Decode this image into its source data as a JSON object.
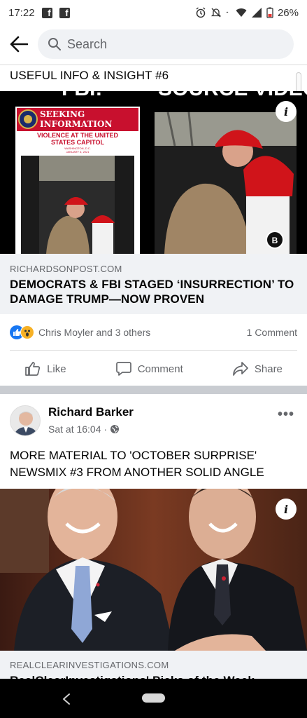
{
  "status_bar": {
    "time": "17:22",
    "battery": "26%",
    "icons": [
      "facebook-icon",
      "facebook-icon",
      "alarm-icon",
      "mute-icon",
      "wifi-icon",
      "signal-icon",
      "battery-icon"
    ]
  },
  "search": {
    "placeholder": "Search"
  },
  "post1": {
    "text": "USEFUL INFO & INSIGHT #6",
    "image_texts": {
      "top_left": "FBI:",
      "top_right": "SOURCE VIDEO:",
      "poster_line1": "SEEKING",
      "poster_line2": "INFORMATION",
      "poster_line3": "VIOLENCE AT THE UNITED",
      "poster_line4": "STATES CAPITOL",
      "poster_line5": "WASHINGTON, D.C.",
      "poster_line6": "JANUARY 6, 2021"
    },
    "link": {
      "domain": "RICHARDSONPOST.COM",
      "title": "DEMOCRATS & FBI STAGED ‘INSURRECTION’ TO DAMAGE TRUMP—NOW PROVEN"
    },
    "reactions": {
      "names": "Chris Moyler and 3 others",
      "comments": "1 Comment"
    },
    "actions": {
      "like": "Like",
      "comment": "Comment",
      "share": "Share"
    }
  },
  "post2": {
    "author": "Richard Barker",
    "time": "Sat at 16:04 ·",
    "text": "MORE MATERIAL TO 'OCTOBER SURPRISE' NEWSMIX #3 FROM ANOTHER SOLID ANGLE",
    "link": {
      "domain": "REALCLEARINVESTIGATIONS.COM",
      "title": "RealClearInvestigations' Picks of the Week"
    }
  },
  "colors": {
    "accent": "#1877f2",
    "wow": "#f7b125",
    "separator": "#c9ccd1",
    "link_bg": "#f0f2f5"
  }
}
